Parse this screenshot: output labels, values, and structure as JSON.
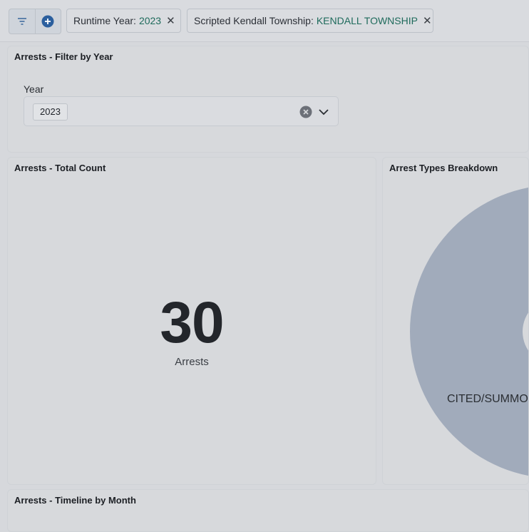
{
  "toolbar": {
    "filter_pills": [
      {
        "key": "Runtime Year:",
        "value": "2023"
      },
      {
        "key": "Scripted Kendall Township:",
        "value": "KENDALL TOWNSHIP"
      }
    ]
  },
  "panels": {
    "filter_by_year": {
      "title": "Arrests - Filter by Year",
      "field_label": "Year",
      "selected": "2023"
    },
    "total_count": {
      "title": "Arrests - Total Count",
      "value": "30",
      "label": "Arrests"
    },
    "arrest_types": {
      "title": "Arrest Types Breakdown",
      "slice_label": "CITED/SUMMONED"
    },
    "timeline": {
      "title": "Arrests - Timeline by Month"
    }
  },
  "chart_data": {
    "type": "pie",
    "title": "Arrest Types Breakdown",
    "slices": [
      {
        "label": "CITED/SUMMONED",
        "value": 30
      }
    ]
  },
  "colors": {
    "slice": "#a1abbb",
    "accent_teal": "#1f6b5c",
    "add_button": "#2b5f9e"
  }
}
